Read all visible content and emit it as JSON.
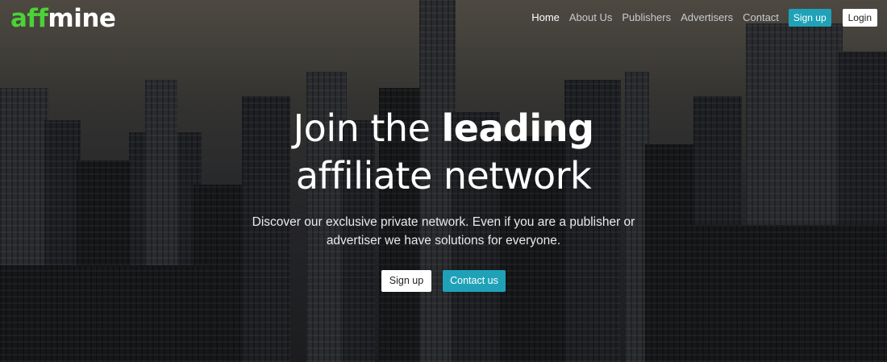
{
  "brand": {
    "logo_part1": "aff",
    "logo_part2": "mine"
  },
  "nav": {
    "items": [
      {
        "label": "Home",
        "active": true
      },
      {
        "label": "About Us",
        "active": false
      },
      {
        "label": "Publishers",
        "active": false
      },
      {
        "label": "Advertisers",
        "active": false
      },
      {
        "label": "Contact",
        "active": false
      }
    ],
    "signup_label": "Sign up",
    "login_label": "Login"
  },
  "hero": {
    "headline_line1_thin": "Join the ",
    "headline_line1_bold": "leading",
    "headline_line2": "affiliate network",
    "subtitle_line1": "Discover our exclusive private network. Even if you are a publisher or",
    "subtitle_line2": "advertiser we have solutions for everyone.",
    "signup_label": "Sign up",
    "contact_label": "Contact us"
  },
  "colors": {
    "accent": "#1fa2b8",
    "logo_green": "#4cd137"
  }
}
